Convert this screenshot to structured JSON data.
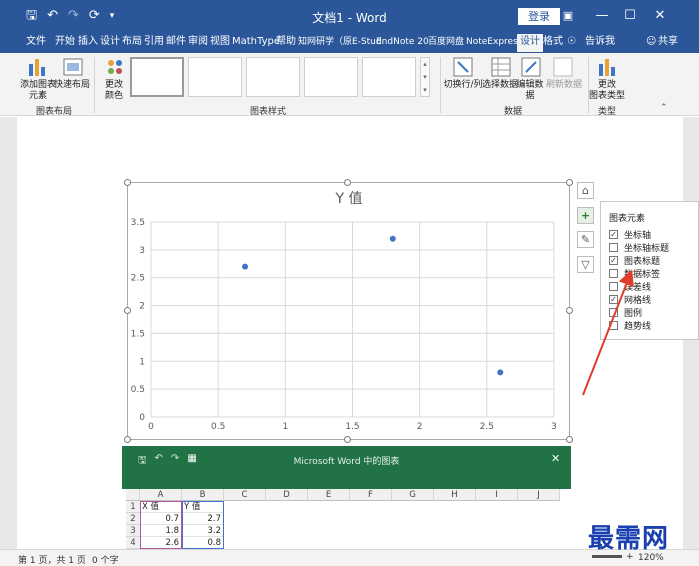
{
  "titlebar": {
    "title": "文档1 - Word",
    "login": "登录",
    "restore_icon": "ribbon-display-icon",
    "min": "—",
    "max": "☐",
    "close": "✕"
  },
  "menu": {
    "tabs": [
      "文件",
      "开始",
      "插入",
      "设计",
      "布局",
      "引用",
      "邮件",
      "审阅",
      "视图",
      "MathType",
      "帮助",
      "知网研学（原E-Stud",
      "EndNote 20",
      "百度网盘",
      "NoteExpress",
      "设计",
      "格式"
    ],
    "active_index": 15,
    "tell_me": "告诉我",
    "share": "共享"
  },
  "ribbon": {
    "add_element": "添加图表\n元素",
    "quick_layout": "快速布局",
    "change_color": "更改\n颜色",
    "group_layouts": "图表布局",
    "group_styles": "图表样式",
    "switch_row_col": "切换行/列",
    "select_data": "选择数据",
    "edit_data": "编辑数\n据",
    "refresh_data": "刷新数据",
    "group_data": "数据",
    "change_type": "更改\n图表类型",
    "group_type": "类型"
  },
  "chart_data": {
    "type": "scatter",
    "title": "Y 值",
    "x": [
      0.7,
      1.8,
      2.6
    ],
    "y": [
      2.7,
      3.2,
      0.8
    ],
    "xlim": [
      0,
      3
    ],
    "ylim": [
      0,
      3.5
    ],
    "x_ticks": [
      "0",
      "0.5",
      "1",
      "1.5",
      "2",
      "2.5",
      "3"
    ],
    "y_ticks": [
      "0",
      "0.5",
      "1",
      "1.5",
      "2",
      "2.5",
      "3",
      "3.5"
    ],
    "grid": true,
    "point_color": "#4472c4"
  },
  "side_buttons": [
    "layout-options-icon",
    "chart-elements-plus-icon",
    "chart-styles-brush-icon",
    "chart-filter-icon"
  ],
  "elements_panel": {
    "title": "图表元素",
    "items": [
      {
        "label": "坐标轴",
        "checked": true
      },
      {
        "label": "坐标轴标题",
        "checked": false
      },
      {
        "label": "图表标题",
        "checked": true
      },
      {
        "label": "数据标签",
        "checked": false
      },
      {
        "label": "误差线",
        "checked": false
      },
      {
        "label": "网格线",
        "checked": true
      },
      {
        "label": "图例",
        "checked": false
      },
      {
        "label": "趋势线",
        "checked": false
      }
    ]
  },
  "excel": {
    "title": "Microsoft Word 中的图表",
    "close": "✕",
    "columns": [
      "A",
      "B",
      "C",
      "D",
      "E",
      "F",
      "G",
      "H",
      "I",
      "J"
    ],
    "rows": [
      {
        "n": "1",
        "a": "X 值",
        "b": "Y 值"
      },
      {
        "n": "2",
        "a": "0.7",
        "b": "2.7"
      },
      {
        "n": "3",
        "a": "1.8",
        "b": "3.2"
      },
      {
        "n": "4",
        "a": "2.6",
        "b": "0.8"
      },
      {
        "n": "5",
        "a": "",
        "b": ""
      }
    ]
  },
  "status": {
    "page": "第 1 页，共 1 页",
    "words": "0 个字",
    "zoom": "120%",
    "zoom_plus": "+"
  },
  "watermark": "最需网"
}
